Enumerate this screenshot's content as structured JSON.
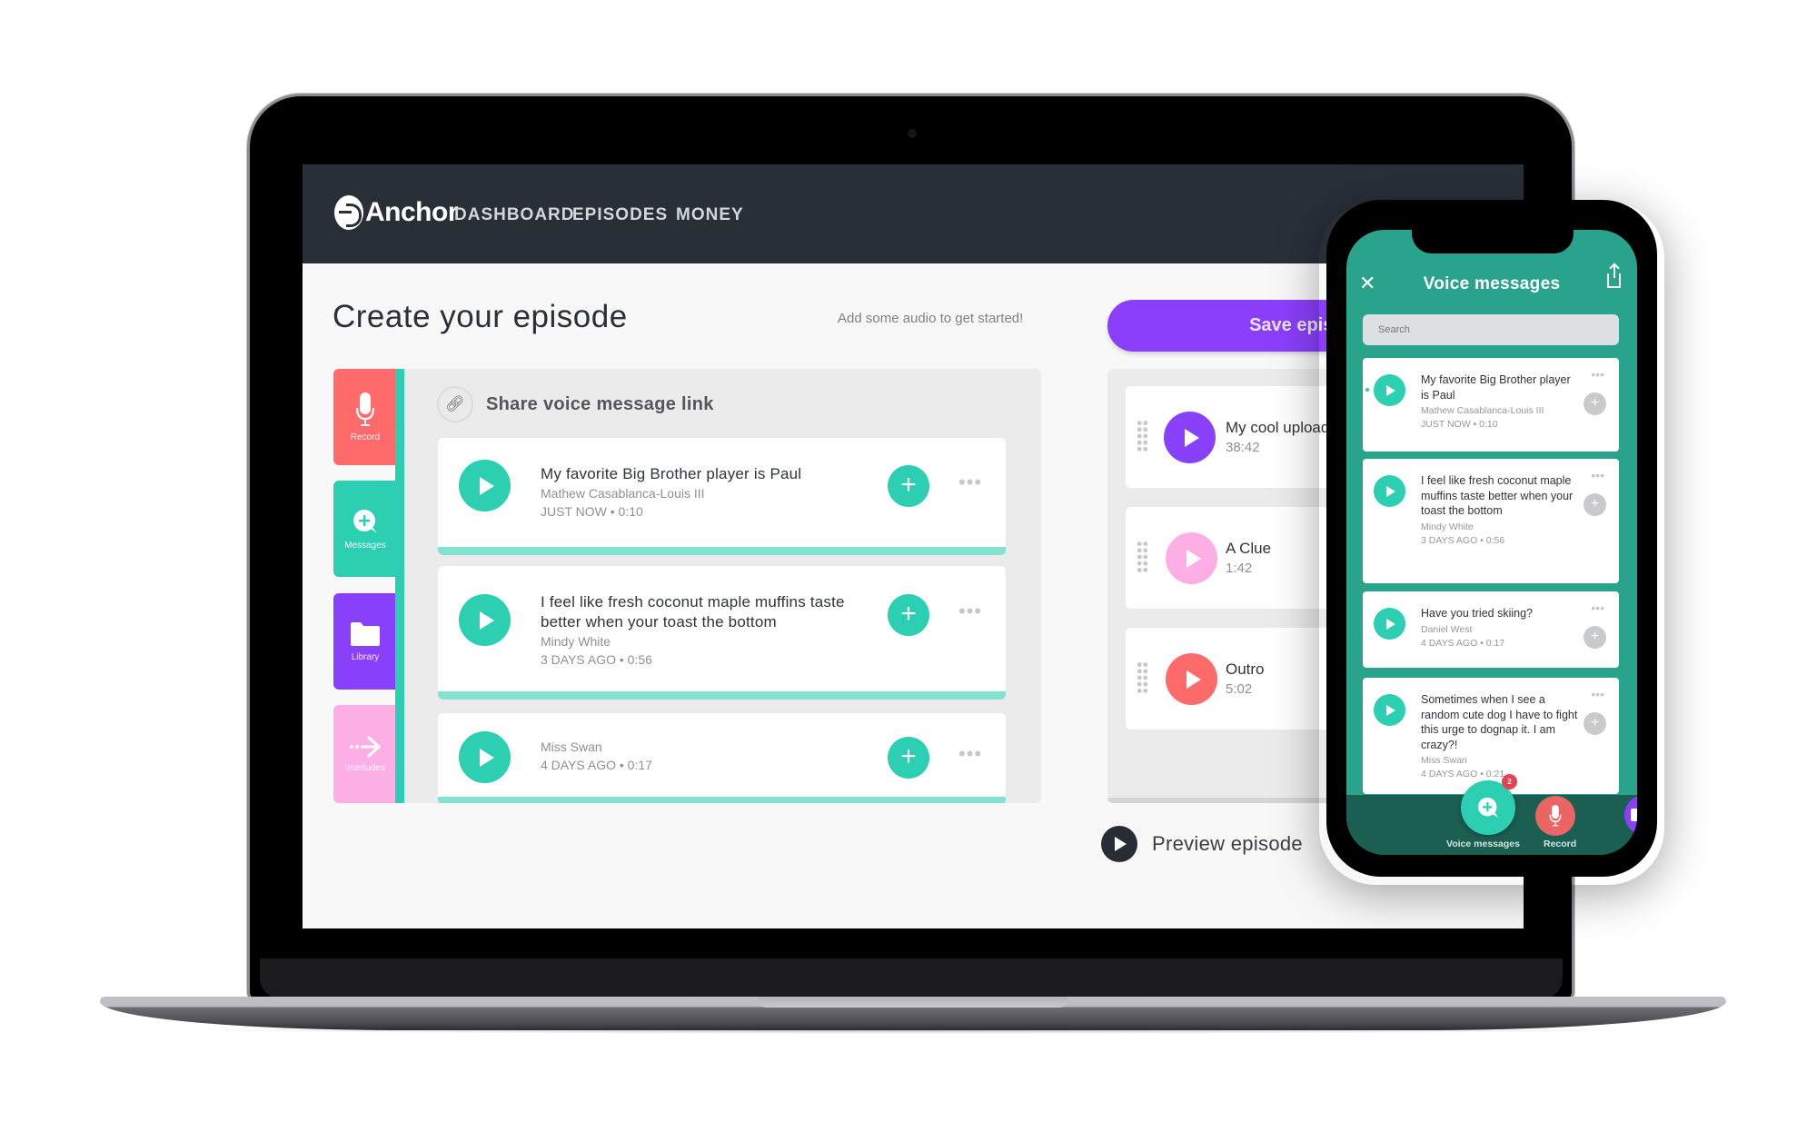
{
  "app": {
    "brand": "Anchor",
    "nav": [
      "DASHBOARD",
      "EPISODES",
      "MONEY"
    ]
  },
  "page": {
    "title": "Create your episode",
    "hint": "Add some audio to get started!",
    "save_label": "Save episode",
    "preview_label": "Preview episode"
  },
  "sidebar": {
    "tiles": [
      {
        "label": "Record",
        "icon": "microphone-icon",
        "color": "#ff6a6a"
      },
      {
        "label": "Messages",
        "icon": "add-message-icon",
        "color": "#2ccfb1"
      },
      {
        "label": "Library",
        "icon": "folder-icon",
        "color": "#8940fa"
      },
      {
        "label": "Interludes",
        "icon": "arrow-right-icon",
        "color": "#fdaee5"
      }
    ]
  },
  "messages": {
    "share_label": "Share voice message link",
    "items": [
      {
        "title": "My favorite Big Brother player is Paul",
        "author": "Mathew Casablanca-Louis III",
        "meta": "JUST NOW • 0:10"
      },
      {
        "title": "I feel like fresh coconut maple muffins taste better when your toast the bottom",
        "author": "Mindy White",
        "meta": "3 DAYS AGO • 0:56"
      },
      {
        "title": "",
        "author": "Miss Swan",
        "meta": "4 DAYS AGO • 0:17"
      }
    ],
    "add_symbol": "+",
    "more_symbol": "•••"
  },
  "episode_segments": [
    {
      "title": "My cool upload",
      "duration": "38:42",
      "color": "#8940fa"
    },
    {
      "title": "A Clue",
      "duration": "1:42",
      "color": "#fdaee5"
    },
    {
      "title": "Outro",
      "duration": "5:02",
      "color": "#ff6a6a"
    }
  ],
  "phone": {
    "title": "Voice messages",
    "close_symbol": "✕",
    "search_placeholder": "Search",
    "items": [
      {
        "title": "My favorite Big Brother player is Paul",
        "author": "Mathew Casablanca-Louis III",
        "meta": "JUST NOW • 0:10",
        "unread": true
      },
      {
        "title": "I feel like fresh coconut maple muffins taste better when your toast the bottom",
        "author": "Mindy White",
        "meta": "3 DAYS AGO • 0:56"
      },
      {
        "title": "Have you tried skiing?",
        "author": "Daniel West",
        "meta": "4 DAYS AGO • 0:17"
      },
      {
        "title": "Sometimes when I see a random cute dog I have to fight this urge to dognap it. I am crazy?!",
        "author": "Miss Swan",
        "meta": "4 DAYS AGO • 0:21"
      }
    ],
    "tabs": [
      {
        "label": "Voice messages",
        "badge": "2"
      },
      {
        "label": "Record"
      }
    ]
  },
  "colors": {
    "teal": "#2ccfb1",
    "purple": "#8b3ffb",
    "nav_bg": "#292f37",
    "phone_bg": "#2aa38c"
  }
}
